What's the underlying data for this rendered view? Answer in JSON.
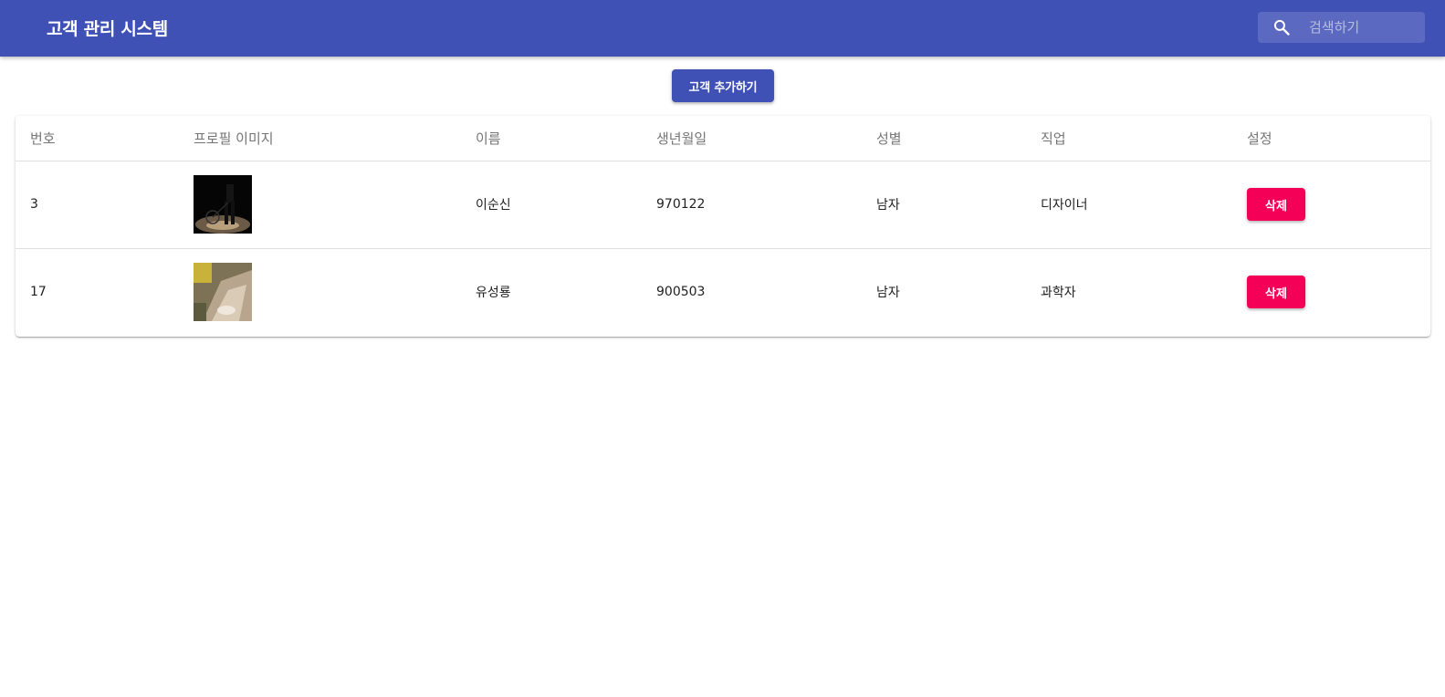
{
  "app": {
    "title": "고객 관리 시스템",
    "colors": {
      "primary": "#3f51b5",
      "danger": "#f50057"
    }
  },
  "search": {
    "icon": "search-icon",
    "placeholder": "검색하기",
    "value": ""
  },
  "toolbar": {
    "add_label": "고객 추가하기"
  },
  "table": {
    "headers": {
      "id": "번호",
      "image": "프로필 이미지",
      "name": "이름",
      "birthday": "생년월일",
      "gender": "성별",
      "job": "직업",
      "settings": "설정"
    },
    "rows": [
      {
        "id": "3",
        "name": "이순신",
        "birthday": "970122",
        "gender": "남자",
        "job": "디자이너",
        "delete_label": "삭제"
      },
      {
        "id": "17",
        "name": "유성룡",
        "birthday": "900503",
        "gender": "남자",
        "job": "과학자",
        "delete_label": "삭제"
      }
    ]
  }
}
